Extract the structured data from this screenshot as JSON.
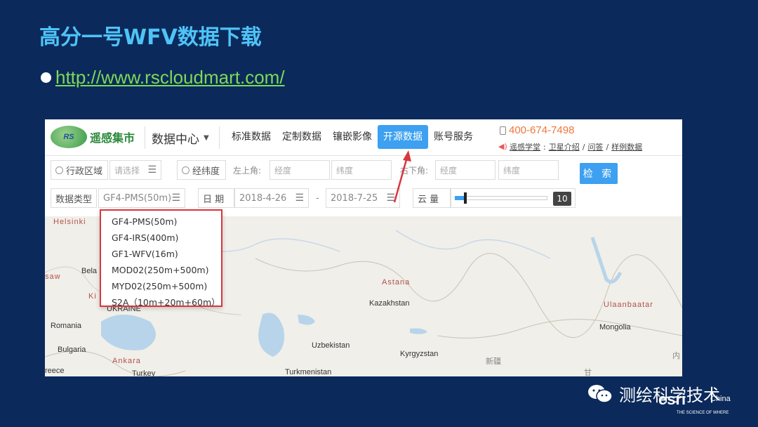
{
  "slide": {
    "title": "高分一号WFV数据下载",
    "link": "http://www.rscloudmart.com/"
  },
  "site": {
    "logo_abbr": "RS",
    "logo_text": "遥感集市",
    "data_center": "数据中心",
    "nav": [
      "标准数据",
      "定制数据",
      "镶嵌影像",
      "开源数据",
      "账号服务"
    ],
    "active_nav": "开源数据",
    "phone": "400-674-7498",
    "links": [
      "遥感学堂",
      "卫星介绍",
      "问答",
      "样例数据"
    ]
  },
  "filters": {
    "admin_region_label": "行政区域",
    "admin_region_placeholder": "请选择",
    "latlon_label": "经纬度",
    "upper_left_label": "左上角:",
    "lower_right_label": "右下角:",
    "lon_placeholder": "经度",
    "lat_placeholder": "纬度",
    "search_label": "检 索",
    "data_type_label": "数据类型",
    "data_type_value": "GF4-PMS(50m)",
    "date_label": "日 期",
    "date_from": "2018-4-26",
    "date_sep": "-",
    "date_to": "2018-7-25",
    "cloud_label": "云 量",
    "cloud_value": "10",
    "cloud_fraction": 0.1
  },
  "dropdown": {
    "options": [
      "GF4-PMS(50m)",
      "GF4-IRS(400m)",
      "GF1-WFV(16m)",
      "MOD02(250m+500m)",
      "MYD02(250m+500m)",
      "S2A（10m+20m+60m）"
    ]
  },
  "map": {
    "labels": {
      "helsinki": "Helsinki",
      "bela": "Bela",
      "saw": "saw",
      "ki": "Ki",
      "ukraine": "UKRAINE",
      "romania": "Romania",
      "bulgaria": "Bulgaria",
      "ankara": "Ankara",
      "turkey": "Turkey",
      "reece": "reece",
      "astana": "Astana",
      "kazakhstan": "Kazakhstan",
      "uzbekistan": "Uzbekistan",
      "turkmenistan": "Turkmenistan",
      "kyrgyzstan": "Kyrgyzstan",
      "ulaanbaatar": "Ulaanbaatar",
      "mongolia": "Mongolia",
      "xinjiang": "新疆",
      "gan": "甘",
      "nei": "内"
    }
  },
  "watermark": {
    "text": "测绘科学技术",
    "esri": "esri",
    "esri_china": "China",
    "esri_tag": "THE SCIENCE OF WHERE"
  }
}
